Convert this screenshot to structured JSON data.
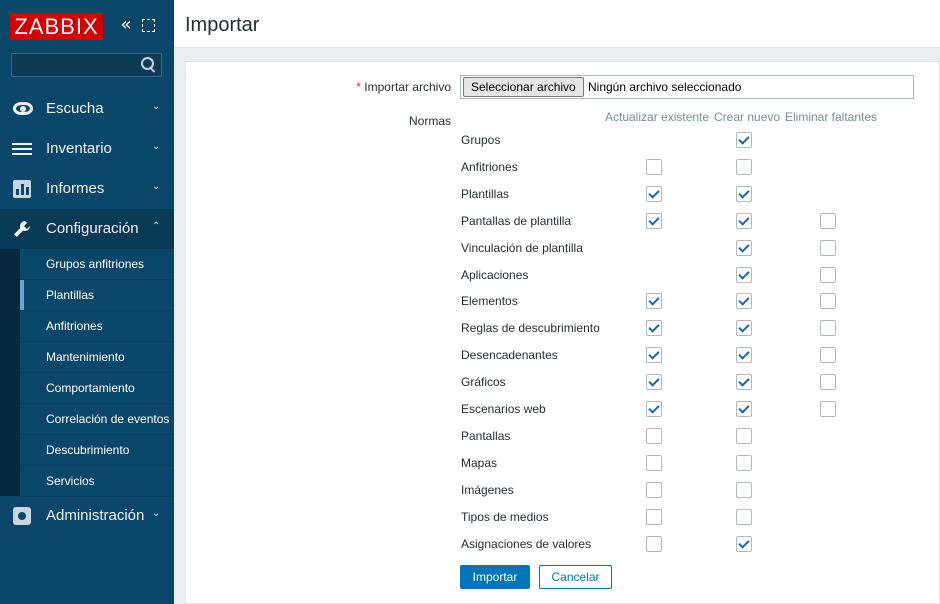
{
  "brand": {
    "logo_text": "ZABBIX",
    "color": "#d40000"
  },
  "sidebar": {
    "collapse_glyph": "«",
    "search": {
      "value": "",
      "placeholder": ""
    },
    "items": [
      {
        "label": "Escucha",
        "icon": "eye-icon"
      },
      {
        "label": "Inventario",
        "icon": "list-icon"
      },
      {
        "label": "Informes",
        "icon": "bar-chart-icon"
      },
      {
        "label": "Configuración",
        "icon": "wrench-icon"
      },
      {
        "label": "Administración",
        "icon": "gear-icon"
      }
    ],
    "submenu": [
      {
        "label": "Grupos anfitriones"
      },
      {
        "label": "Plantillas",
        "selected": true
      },
      {
        "label": "Anfitriones"
      },
      {
        "label": "Mantenimiento"
      },
      {
        "label": "Comportamiento"
      },
      {
        "label": "Correlación de eventos"
      },
      {
        "label": "Descubrimiento"
      },
      {
        "label": "Servicios"
      }
    ]
  },
  "header": {
    "title": "Importar"
  },
  "form": {
    "file_label": "Importar archivo",
    "required_mark": "*",
    "file_button": "Seleccionar archivo",
    "file_status": "Ningún archivo seleccionado",
    "rules_label": "Normas",
    "columns": [
      "Actualizar existente",
      "Crear nuevo",
      "Eliminar faltantes"
    ],
    "rules": [
      {
        "label": "Grupos",
        "update": null,
        "create": true,
        "delete": null
      },
      {
        "label": "Anfitriones",
        "update": false,
        "create": false,
        "delete": null
      },
      {
        "label": "Plantillas",
        "update": true,
        "create": true,
        "delete": null
      },
      {
        "label": "Pantallas de plantilla",
        "update": true,
        "create": true,
        "delete": false
      },
      {
        "label": "Vinculación de plantilla",
        "update": null,
        "create": true,
        "delete": false
      },
      {
        "label": "Aplicaciones",
        "update": null,
        "create": true,
        "delete": false
      },
      {
        "label": "Elementos",
        "update": true,
        "create": true,
        "delete": false
      },
      {
        "label": "Reglas de descubrimiento",
        "update": true,
        "create": true,
        "delete": false
      },
      {
        "label": "Desencadenantes",
        "update": true,
        "create": true,
        "delete": false
      },
      {
        "label": "Gráficos",
        "update": true,
        "create": true,
        "delete": false
      },
      {
        "label": "Escenarios web",
        "update": true,
        "create": true,
        "delete": false
      },
      {
        "label": "Pantallas",
        "update": false,
        "create": false,
        "delete": null
      },
      {
        "label": "Mapas",
        "update": false,
        "create": false,
        "delete": null
      },
      {
        "label": "Imágenes",
        "update": false,
        "create": false,
        "delete": null
      },
      {
        "label": "Tipos de medios",
        "update": false,
        "create": false,
        "delete": null
      },
      {
        "label": "Asignaciones de valores",
        "update": false,
        "create": true,
        "delete": null
      }
    ],
    "import_button": "Importar",
    "cancel_button": "Cancelar"
  },
  "colors": {
    "sidebar_bg": "#0a466a",
    "accent": "#0275b8",
    "check": "#1f65a6"
  }
}
